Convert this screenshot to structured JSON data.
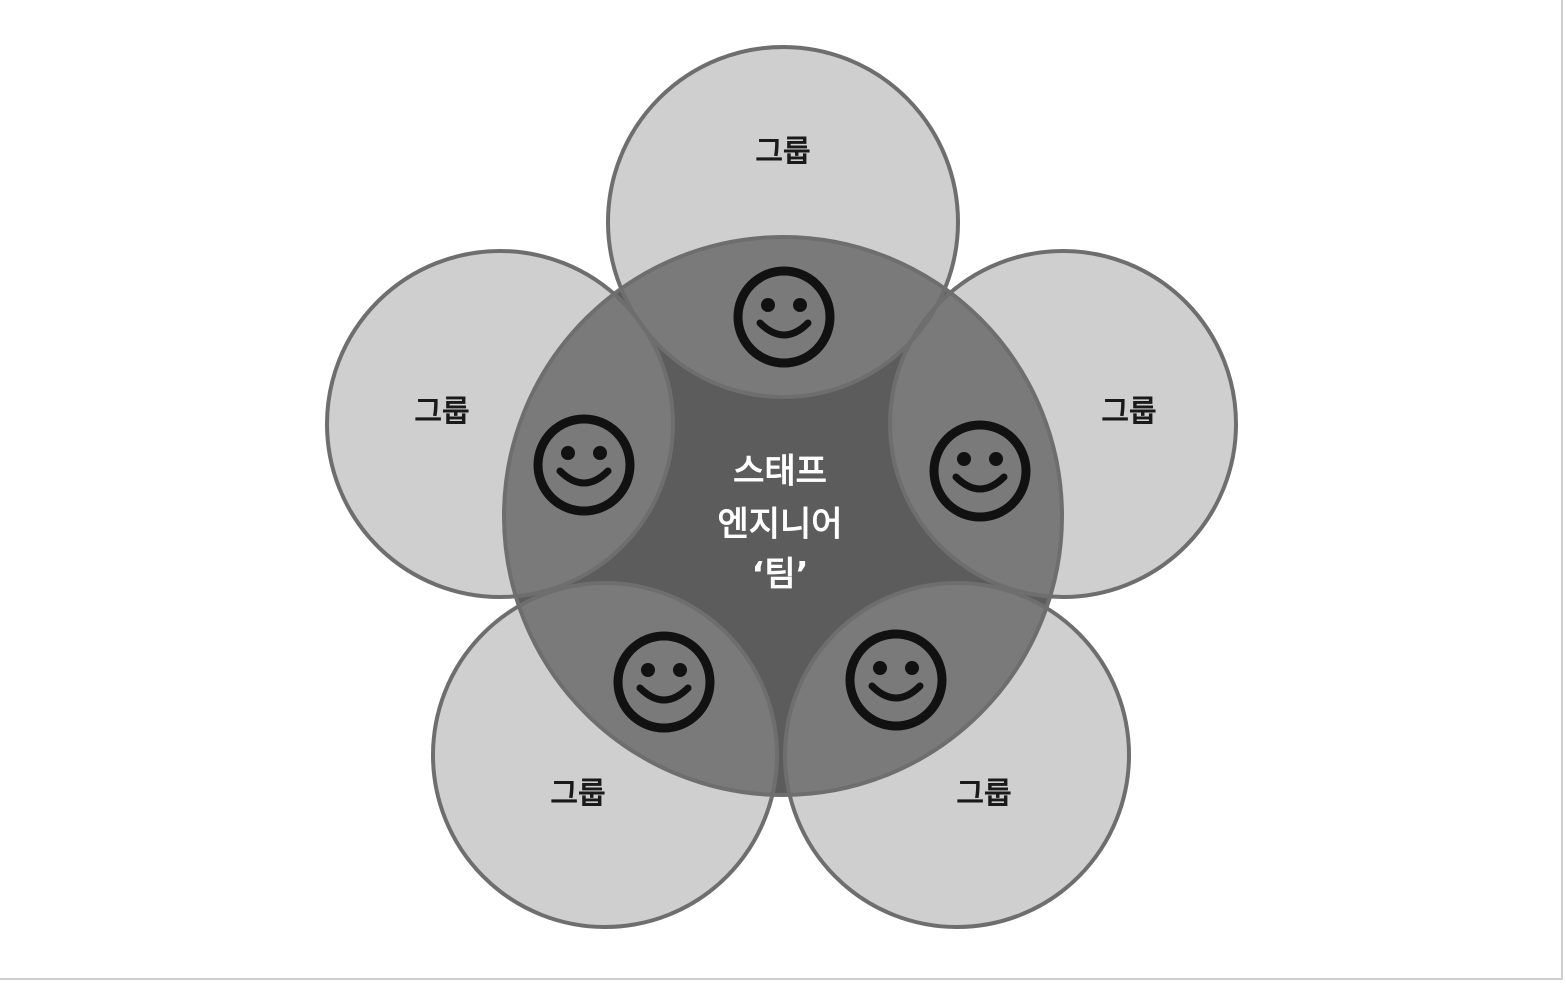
{
  "diagram": {
    "center_label": [
      "스태프",
      "엔지니어",
      "‘팀’"
    ],
    "groups": [
      {
        "label": "그룹",
        "icon": "smiley-icon"
      },
      {
        "label": "그룹",
        "icon": "smiley-icon"
      },
      {
        "label": "그룹",
        "icon": "smiley-icon"
      },
      {
        "label": "그룹",
        "icon": "smiley-icon"
      },
      {
        "label": "그룹",
        "icon": "smiley-icon"
      }
    ],
    "colors": {
      "outer_fill": "#cfcfcf",
      "outer_stroke": "#6e6e6e",
      "team_fill": "#5c5c5c",
      "overlap_fill": "#7a7a7a",
      "face_stroke": "#111111",
      "group_text": "#1a1a1a",
      "team_text": "#ffffff"
    }
  }
}
